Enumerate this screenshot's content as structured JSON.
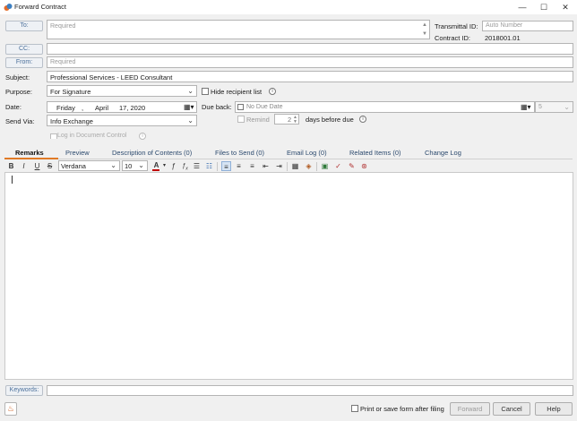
{
  "window": {
    "title": "Forward Contract",
    "minimize_glyph": "—",
    "maximize_glyph": "☐",
    "close_glyph": "✕"
  },
  "to": {
    "label": "To:",
    "placeholder": "Required"
  },
  "cc": {
    "label": "CC:"
  },
  "from": {
    "label": "From:",
    "placeholder": "Required"
  },
  "transmittal": {
    "label": "Transmittal ID:",
    "placeholder": "Auto Number"
  },
  "contract": {
    "label": "Contract ID:",
    "value": "2018001.01"
  },
  "subject": {
    "label": "Subject:",
    "value": "Professional Services - LEED Consultant"
  },
  "purpose": {
    "label": "Purpose:",
    "value": "For Signature"
  },
  "hide_recipient": {
    "label": "Hide recipient list",
    "checked": false
  },
  "date": {
    "label": "Date:",
    "weekday": "Friday",
    "sep": ",",
    "month": "April",
    "day_year": "17, 2020"
  },
  "due_back": {
    "label": "Due back:",
    "placeholder": "No Due Date",
    "days_value": "5"
  },
  "remind": {
    "label": "Remind",
    "days": "2",
    "suffix": "days before due"
  },
  "send_via": {
    "label": "Send Via:",
    "value": "Info Exchange"
  },
  "log_doc_control": {
    "label": "Log in Document Control"
  },
  "tabs": [
    {
      "label": "Remarks",
      "active": true
    },
    {
      "label": "Preview"
    },
    {
      "label": "Description of Contents (0)"
    },
    {
      "label": "Files to Send (0)"
    },
    {
      "label": "Email Log (0)"
    },
    {
      "label": "Related Items (0)"
    },
    {
      "label": "Change Log"
    }
  ],
  "toolbar": {
    "bold": "B",
    "italic": "I",
    "underline": "U",
    "strike": "S",
    "font": "Verdana",
    "size": "10",
    "font_color": "A"
  },
  "keywords": {
    "label": "Keywords:"
  },
  "footer": {
    "print_label": "Print or save form after filing",
    "forward": "Forward",
    "cancel": "Cancel",
    "help": "Help"
  },
  "colors": {
    "accent_tab": "#e07a26",
    "link_blue": "#4a6f9a",
    "font_color_bar": "#c00000"
  }
}
